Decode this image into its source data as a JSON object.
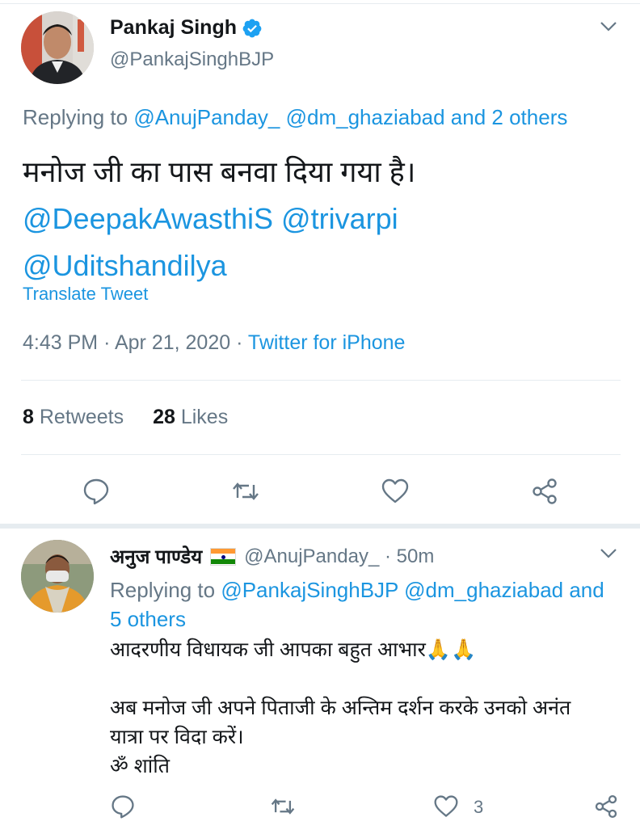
{
  "main_tweet": {
    "author_name": "Pankaj Singh",
    "handle": "@PankajSinghBJP",
    "replying_prefix": "Replying to",
    "replying_to": "@AnujPanday_ @dm_ghaziabad and 2 others",
    "text_line1": "मनोज जी का पास बनवा दिया गया है।",
    "text_line2": "@DeepakAwasthiS @trivarpi",
    "text_line3": "@Uditshandilya",
    "translate_label": "Translate Tweet",
    "time": "4:43 PM",
    "date": "Apr 21, 2020",
    "source": "Twitter for iPhone",
    "retweets_count": "8",
    "retweets_label": "Retweets",
    "likes_count": "28",
    "likes_label": "Likes"
  },
  "reply_tweet": {
    "author_name": "अनुज पाण्डेय",
    "handle": "@AnujPanday_",
    "time_ago": "50m",
    "replying_prefix": "Replying to",
    "replying_to": "@PankajSinghBJP @dm_ghaziabad and 5 others",
    "para1": "आदरणीय विधायक जी आपका बहुत आभार🙏🙏",
    "para2_line1": "अब मनोज जी अपने पिताजी के अन्तिम दर्शन करके उनको अनंत",
    "para2_line2": "यात्रा पर विदा करें।",
    "para3": "ॐ शांति",
    "like_count": "3"
  },
  "icons": [
    "verified-icon",
    "chevron-down-icon",
    "reply-icon",
    "retweet-icon",
    "like-icon",
    "share-icon",
    "india-flag-icon"
  ],
  "colors": {
    "link": "#1b95e0",
    "muted": "#657786",
    "text": "#14171a",
    "divider": "#e6ecf0",
    "verified": "#1da1f2"
  }
}
